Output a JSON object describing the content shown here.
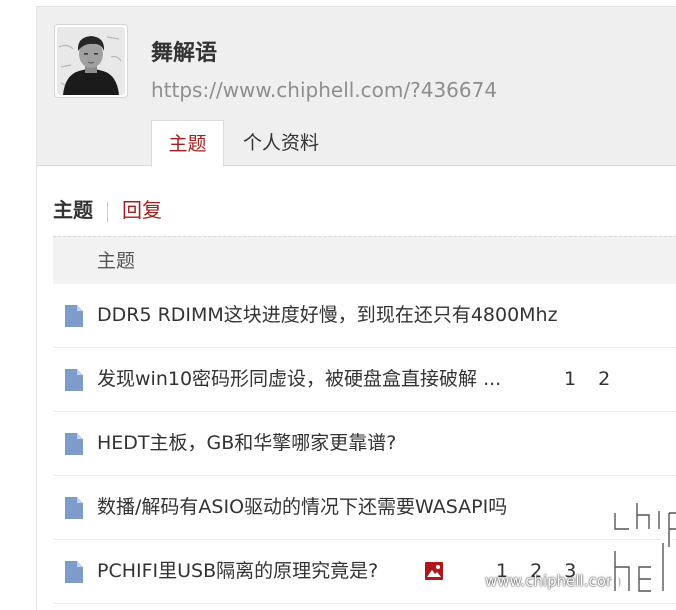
{
  "profile": {
    "username": "舞解语",
    "url": "https://www.chiphell.com/?436674",
    "tabs": [
      {
        "label": "主题",
        "active": true
      },
      {
        "label": "个人资料",
        "active": false
      }
    ]
  },
  "subnav": {
    "active": "主题",
    "link": "回复"
  },
  "table": {
    "header": "主题",
    "rows": [
      {
        "title": "DDR5 RDIMM这块进度好慢，到现在还只有4800Mhz",
        "pages": [],
        "has_image": false
      },
      {
        "title": "发现win10密码形同虚设，被硬盘盒直接破解 ...",
        "pages": [
          "1",
          "2"
        ],
        "has_image": false
      },
      {
        "title": "HEDT主板，GB和华擎哪家更靠谱?",
        "pages": [],
        "has_image": false
      },
      {
        "title": "数播/解码有ASIO驱动的情况下还需要WASAPI吗",
        "pages": [],
        "has_image": false
      },
      {
        "title": "PCHIFI里USB隔离的原理究竟是?",
        "pages": [
          "1",
          "2",
          "3"
        ],
        "has_image": true
      }
    ]
  },
  "watermark": {
    "url": "www.chiphell.com",
    "logo_icon": "chiphell-logo"
  },
  "icons": {
    "row_icon": "file-icon",
    "image_icon": "image-icon"
  },
  "colors": {
    "accent": "#a71d1d",
    "icon_blue": "#7d9ccc",
    "header_bg": "#efefef"
  }
}
